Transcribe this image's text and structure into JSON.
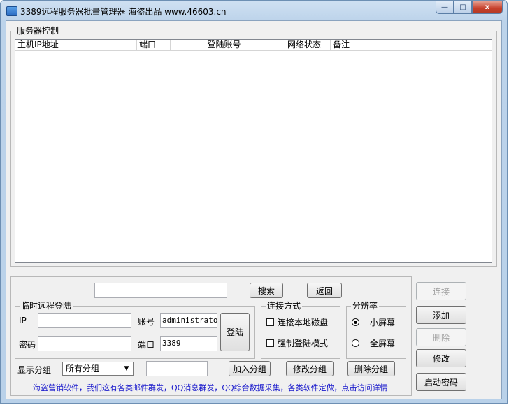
{
  "window": {
    "title": "3389远程服务器批量管理器 海盗出品 www.46603.cn",
    "minimize_glyph": "—",
    "maximize_glyph": "□",
    "close_glyph": "x"
  },
  "server_control": {
    "legend": "服务器控制",
    "columns": [
      "主机IP地址",
      "端口",
      "登陆账号",
      "网络状态",
      "备注"
    ],
    "rows": []
  },
  "search": {
    "value": "",
    "search_label": "搜索",
    "back_label": "返回"
  },
  "temp_login": {
    "legend": "临时远程登陆",
    "ip_label": "IP",
    "ip_value": "",
    "password_label": "密码",
    "password_value": "",
    "account_label": "账号",
    "account_value": "administrator",
    "port_label": "端口",
    "port_value": "3389",
    "login_label": "登陆"
  },
  "connect_mode": {
    "legend": "连接方式",
    "local_disk_label": "连接本地磁盘",
    "force_login_label": "强制登陆模式"
  },
  "resolution": {
    "legend": "分辨率",
    "small_label": "小屏幕",
    "full_label": "全屏幕",
    "selected": "small"
  },
  "group": {
    "label": "显示分组",
    "selected": "所有分组",
    "name_value": "",
    "add_label": "加入分组",
    "edit_label": "修改分组",
    "delete_label": "删除分组"
  },
  "side_buttons": {
    "connect": "连接",
    "add": "添加",
    "delete": "删除",
    "modify": "修改",
    "start_password": "启动密码"
  },
  "promo_link": "海盗营销软件，我们这有各类邮件群发，QQ消息群发，QQ综合数据采集，各类软件定做，点击访问详情"
}
